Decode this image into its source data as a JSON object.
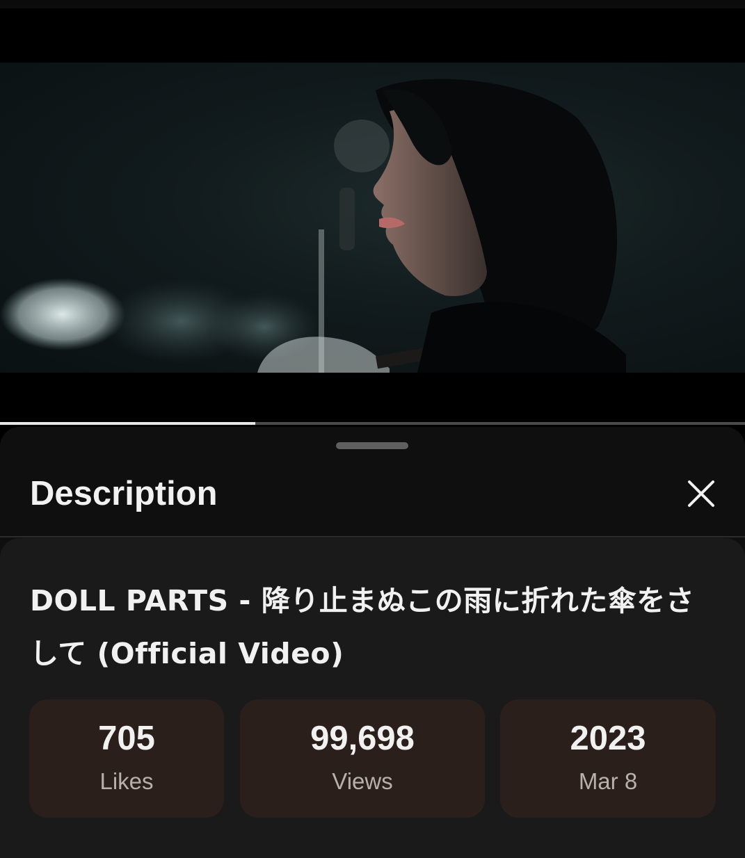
{
  "video": {
    "progress_fraction": 0.343
  },
  "sheet": {
    "title": "Description"
  },
  "details": {
    "video_title": "DOLL PARTS - 降り止まぬこの雨に折れた傘をさして (Official Video)",
    "stats": [
      {
        "value": "705",
        "label": "Likes"
      },
      {
        "value": "99,698",
        "label": "Views"
      },
      {
        "value": "2023",
        "label": "Mar 8"
      }
    ]
  },
  "colors": {
    "sheet_background": "#0f0f0f",
    "card_background": "#1a1a1a",
    "stat_box_background": "#2a1f1a",
    "progress_fill": "#e6e6e6"
  },
  "icons": {
    "close": "close-icon"
  }
}
